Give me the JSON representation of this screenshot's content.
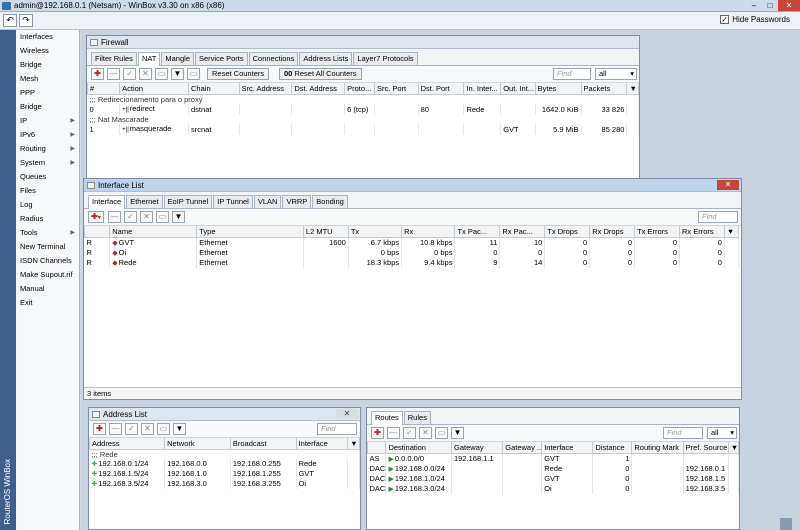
{
  "app": {
    "title": "admin@192.168.0.1 (Netsam) - WinBox v3.30 on x86 (x86)",
    "hide_passwords": "Hide Passwords",
    "undo": "↶",
    "redo": "↷",
    "win_min": "–",
    "win_max": "□",
    "win_close": "✕",
    "side_label": "RouterOS WinBox",
    "check": "✓",
    "close": "✕"
  },
  "menu": [
    {
      "label": "Interfaces",
      "arrow": ""
    },
    {
      "label": "Wireless",
      "arrow": ""
    },
    {
      "label": "Bridge",
      "arrow": ""
    },
    {
      "label": "Mesh",
      "arrow": ""
    },
    {
      "label": "PPP",
      "arrow": ""
    },
    {
      "label": "Bridge",
      "arrow": ""
    },
    {
      "label": "IP",
      "arrow": "▶"
    },
    {
      "label": "IPv6",
      "arrow": "▶"
    },
    {
      "label": "Routing",
      "arrow": "▶"
    },
    {
      "label": "System",
      "arrow": "▶"
    },
    {
      "label": "Queues",
      "arrow": ""
    },
    {
      "label": "Files",
      "arrow": ""
    },
    {
      "label": "Log",
      "arrow": ""
    },
    {
      "label": "Radius",
      "arrow": ""
    },
    {
      "label": "Tools",
      "arrow": "▶"
    },
    {
      "label": "New Terminal",
      "arrow": ""
    },
    {
      "label": "ISDN Channels",
      "arrow": ""
    },
    {
      "label": "Make Supout.rif",
      "arrow": ""
    },
    {
      "label": "Manual",
      "arrow": ""
    },
    {
      "label": "Exit",
      "arrow": ""
    }
  ],
  "tool_glyphs": {
    "add": "✚",
    "remove": "—",
    "enable": "✓",
    "disable": "✕",
    "comment": "▭",
    "filter": "▼",
    "drop": "▾",
    "sort": "▼"
  },
  "firewall": {
    "title": "Firewall",
    "tabs": [
      "Filter Rules",
      "NAT",
      "Mangle",
      "Service Ports",
      "Connections",
      "Address Lists",
      "Layer7 Protocols"
    ],
    "reset_counters": "Reset Counters",
    "reset_all_counters": "Reset All Counters",
    "oo": "00",
    "find_placeholder": "Find",
    "filter_value": "all",
    "columns": [
      "#",
      "Action",
      "Chain",
      "Src. Address",
      "Dst. Address",
      "Proto...",
      "Src. Port",
      "Dst. Port",
      "In. Inter...",
      "Out. Int...",
      "Bytes",
      "Packets"
    ],
    "rows": [
      {
        "comment": ";;; Redirecionamento para o proxy"
      },
      {
        "num": "0",
        "action": "redirect",
        "chain": "dstnat",
        "src": "",
        "dst": "",
        "proto": "6 (tcp)",
        "sport": "",
        "dport": "80",
        "in": "Rede",
        "out": "",
        "bytes": "1642.0 KiB",
        "packets": "33 826"
      },
      {
        "comment": ";;; Nat Mascarade"
      },
      {
        "num": "1",
        "action": "masquerade",
        "chain": "srcnat",
        "src": "",
        "dst": "",
        "proto": "",
        "sport": "",
        "dport": "",
        "in": "",
        "out": "GVT",
        "bytes": "5.9 MiB",
        "packets": "85 280"
      }
    ]
  },
  "interfaces": {
    "title": "Interface List",
    "tabs": [
      "Interface",
      "Ethernet",
      "EoIP Tunnel",
      "IP Tunnel",
      "VLAN",
      "VRRP",
      "Bonding"
    ],
    "find_placeholder": "Find",
    "columns": [
      "",
      "Name",
      "Type",
      "L2 MTU",
      "Tx",
      "Rx",
      "Tx Pac...",
      "Rx Pac...",
      "Tx Drops",
      "Rx Drops",
      "Tx Errors",
      "Rx Errors"
    ],
    "rows": [
      {
        "flag": "R",
        "name": "GVT",
        "type": "Ethernet",
        "l2mtu": "1600",
        "tx": "6.7 kbps",
        "rx": "10.8 kbps",
        "txp": "11",
        "rxp": "10",
        "txd": "0",
        "rxd": "0",
        "txe": "0",
        "rxe": "0"
      },
      {
        "flag": "R",
        "name": "Oi",
        "type": "Ethernet",
        "l2mtu": "",
        "tx": "0 bps",
        "rx": "0 bps",
        "txp": "0",
        "rxp": "0",
        "txd": "0",
        "rxd": "0",
        "txe": "0",
        "rxe": "0"
      },
      {
        "flag": "R",
        "name": "Rede",
        "type": "Ethernet",
        "l2mtu": "",
        "tx": "18.3 kbps",
        "rx": "9.4 kbps",
        "txp": "9",
        "rxp": "14",
        "txd": "0",
        "rxd": "0",
        "txe": "0",
        "rxe": "0"
      }
    ],
    "status": "3 items"
  },
  "addresses": {
    "title": "Address List",
    "find_placeholder": "Find",
    "columns": [
      "Address",
      "Network",
      "Broadcast",
      "Interface"
    ],
    "comment": ";;; Rede",
    "rows": [
      {
        "address": "192.168.0.1/24",
        "network": "192.168.0.0",
        "broadcast": "192.168.0.255",
        "iface": "Rede"
      },
      {
        "address": "192.168.1.5/24",
        "network": "192.168.1.0",
        "broadcast": "192.168.1.255",
        "iface": "GVT"
      },
      {
        "address": "192.168.3.5/24",
        "network": "192.168.3.0",
        "broadcast": "192.168.3.255",
        "iface": "Oi"
      }
    ]
  },
  "routes": {
    "tabs": [
      "Routes",
      "Rules"
    ],
    "find_placeholder": "Find",
    "filter_value": "all",
    "columns": [
      "",
      "Destination",
      "Gateway",
      "Gateway ...",
      "Interface",
      "Distance",
      "Routing Mark",
      "Pref. Source"
    ],
    "rows": [
      {
        "flag": "AS",
        "dest": "0.0.0.0/0",
        "gw": "192.168.1.1",
        "gws": "",
        "iface": "GVT",
        "dist": "1",
        "mark": "",
        "pref": ""
      },
      {
        "flag": "DAC",
        "dest": "192.168.0.0/24",
        "gw": "",
        "gws": "",
        "iface": "Rede",
        "dist": "0",
        "mark": "",
        "pref": "192.168.0.1"
      },
      {
        "flag": "DAC",
        "dest": "192.168.1.0/24",
        "gw": "",
        "gws": "",
        "iface": "GVT",
        "dist": "0",
        "mark": "",
        "pref": "192.168.1.5"
      },
      {
        "flag": "DAC",
        "dest": "192.168.3.0/24",
        "gw": "",
        "gws": "",
        "iface": "Oi",
        "dist": "0",
        "mark": "",
        "pref": "192.168.3.5"
      }
    ]
  },
  "colors": {
    "accent": "#3e5f8c",
    "close": "#c8443a",
    "add": "#c41e1e"
  }
}
